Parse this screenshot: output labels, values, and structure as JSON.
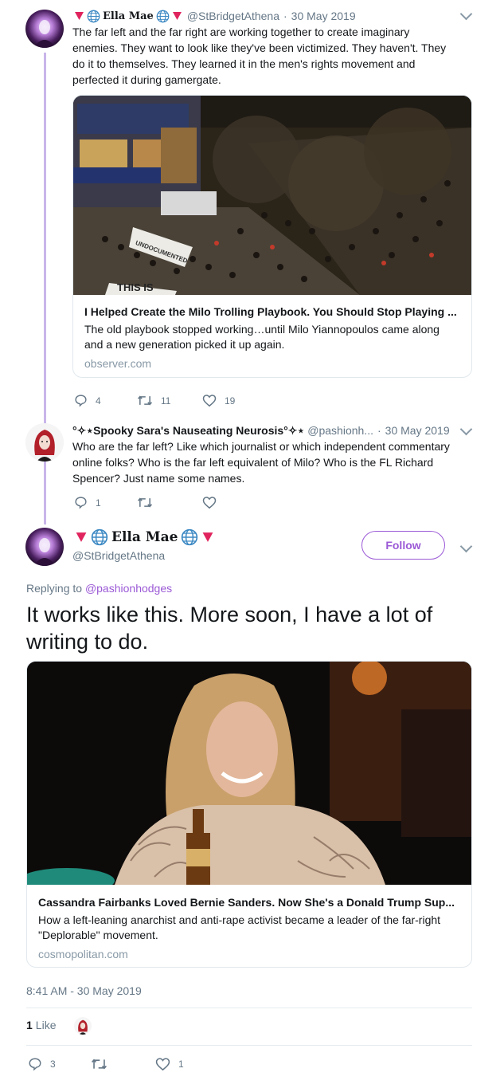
{
  "tweet1": {
    "display_name": "Ella Mae",
    "handle": "@StBridgetAthena",
    "sep": "·",
    "date": "30 May 2019",
    "text": "The far left and the far right are working together to create imaginary enemies. They want to look like they've been victimized. They haven't. They do it to themselves. They learned it in the men's rights movement and perfected it during gamergate.",
    "card": {
      "title": "I Helped Create the Milo Trolling Playbook. You Should Stop Playing ...",
      "description": "The old playbook stopped working…until Milo Yiannopoulos came along and a new generation picked it up again.",
      "domain": "observer.com",
      "banner_text": "THIS IS",
      "sign_text": "UNDOCUMENTED"
    },
    "replies": "4",
    "retweets": "11",
    "likes": "19"
  },
  "tweet2": {
    "display_name": "°✧⋆Spooky Sara's Nauseating Neurosis°✧⋆",
    "handle": "@pashionh...",
    "sep": "·",
    "date": "30 May 2019",
    "text": "Who are the far left? Like which journalist or which independent commentary online folks? Who is the far left equivalent of Milo? Who is the FL Richard Spencer? Just name some names.",
    "replies": "1"
  },
  "main_tweet": {
    "display_name": "Ella Mae",
    "handle": "@StBridgetAthena",
    "follow_label": "Follow",
    "replying_prefix": "Replying to",
    "replying_to": "@pashionhodges",
    "text": "It works like this. More soon, I have a lot of writing to do.",
    "card": {
      "title": "Cassandra Fairbanks Loved Bernie Sanders. Now She's a Donald Trump Sup...",
      "description": "How a left-leaning anarchist and anti-rape activist became a leader of the far-right \"Deplorable\" movement.",
      "domain": "cosmopolitan.com"
    },
    "timestamp": "8:41 AM - 30 May 2019",
    "like_count": "1",
    "like_label": "Like",
    "replies": "3",
    "likes": "1"
  },
  "colors": {
    "accent": "#9b59d6",
    "thread_line": "#c9b6ea",
    "muted": "#657786",
    "border": "#e1e8ed",
    "triangle": "#e0245e",
    "globe": "#3b88c3"
  }
}
